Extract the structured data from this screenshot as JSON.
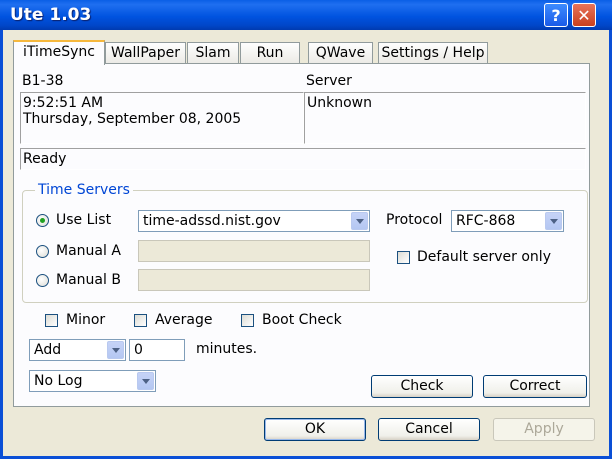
{
  "window": {
    "title": "Ute 1.03",
    "help_glyph": "?",
    "close_glyph": "✕"
  },
  "tabs": [
    {
      "label": "iTimeSync",
      "active": true
    },
    {
      "label": "WallPaper"
    },
    {
      "label": "Slam"
    },
    {
      "label": "Run"
    },
    {
      "label": "QWave"
    },
    {
      "label": "Settings / Help"
    }
  ],
  "computer": {
    "name": "B1-38",
    "time": "9:52:51 AM",
    "date": "Thursday, September 08, 2005"
  },
  "server": {
    "label": "Server",
    "value": "Unknown"
  },
  "status": "Ready",
  "time_servers": {
    "title": "Time Servers",
    "use_list_label": "Use List",
    "use_list_value": "time-adssd.nist.gov",
    "manual_a_label": "Manual A",
    "manual_b_label": "Manual B",
    "selected": "Use List"
  },
  "protocol": {
    "label": "Protocol",
    "value": "RFC-868"
  },
  "default_server_only_label": "Default server only",
  "options": {
    "minor": "Minor",
    "average": "Average",
    "boot_check": "Boot Check"
  },
  "offset": {
    "mode": "Add",
    "value": "0",
    "unit": "minutes."
  },
  "log": {
    "value": "No Log"
  },
  "buttons": {
    "check": "Check",
    "correct": "Correct",
    "ok": "OK",
    "cancel": "Cancel",
    "apply": "Apply"
  },
  "colors": {
    "titlebar": "#0053e0",
    "group_title": "#0046d5",
    "radio_selected": "#21a121"
  }
}
